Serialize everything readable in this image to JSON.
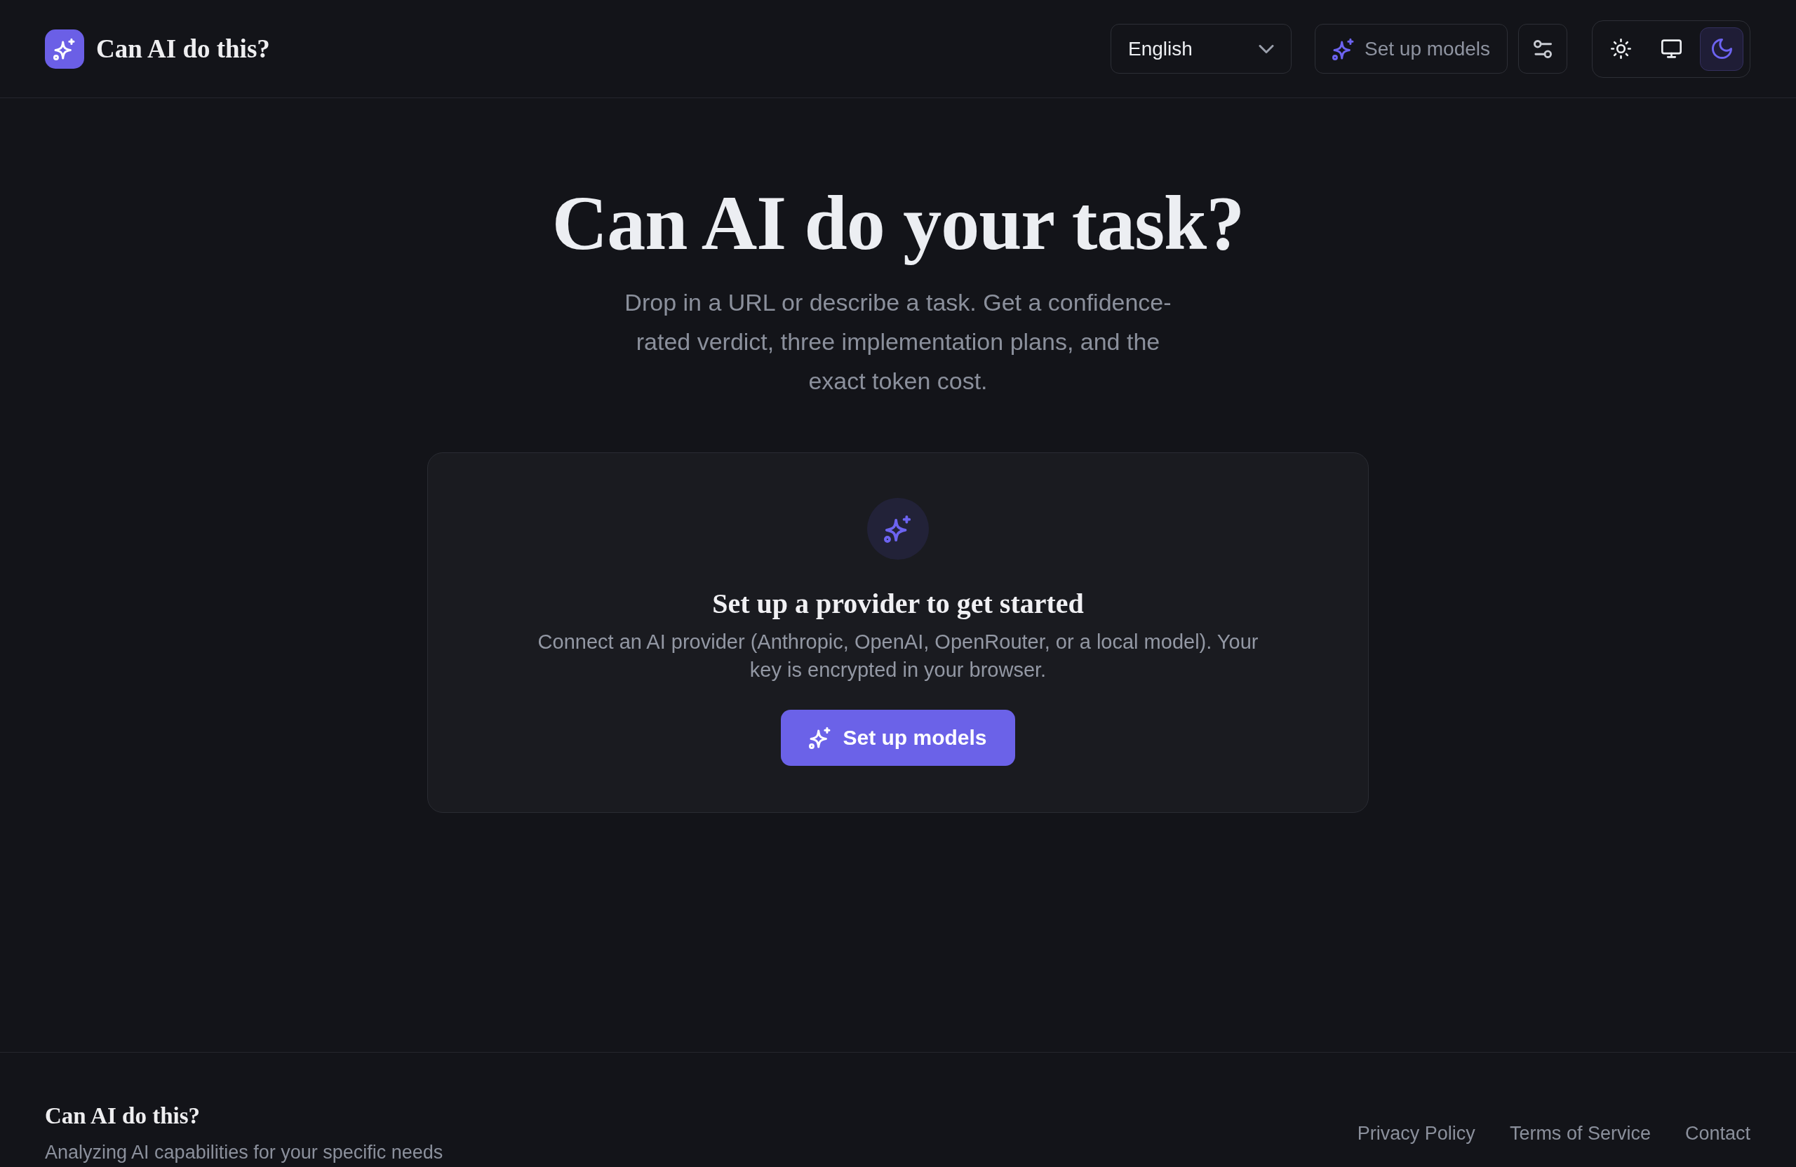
{
  "header": {
    "logo_title": "Can AI do this?",
    "language_select": {
      "value": "English"
    },
    "setup_button": {
      "label": "Set up models"
    },
    "theme_options": [
      {
        "selected": false
      },
      {
        "selected": false
      },
      {
        "selected": true
      }
    ]
  },
  "hero": {
    "title": "Can AI do your task?",
    "subtitle": "Drop in a URL or describe a task. Get a confidence-rated verdict, three implementation plans, and the exact token cost."
  },
  "setup_card": {
    "title": "Set up a provider to get started",
    "description": "Connect an AI provider (Anthropic, OpenAI, OpenRouter, or a local model). Your key is encrypted in your browser.",
    "button": {
      "label": "Set up models"
    }
  },
  "footer": {
    "title": "Can AI do this?",
    "tagline": "Analyzing AI capabilities for your specific needs",
    "links": [
      "Privacy Policy",
      "Terms of Service",
      "Contact"
    ]
  }
}
